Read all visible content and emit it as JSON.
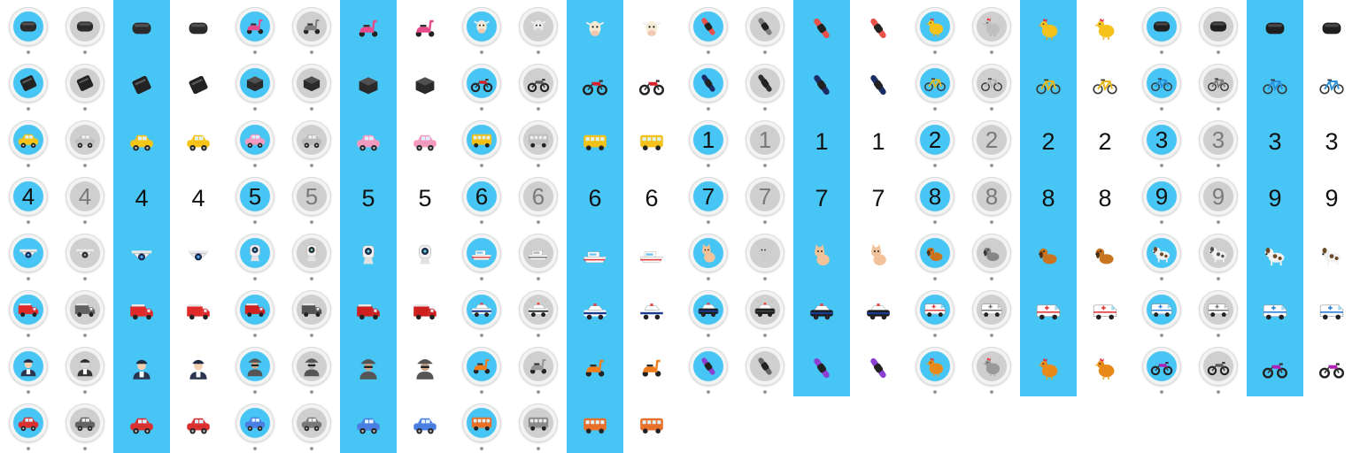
{
  "sheet": {
    "colors": {
      "band": "#47c6f5",
      "badge_color": "#47c6f5",
      "badge_gray": "#cfcfcf",
      "ring": "#f4f4f4",
      "pin_dot": "#9a9a9a"
    },
    "variants": [
      "badge-color",
      "badge-gray",
      "band",
      "plain"
    ],
    "rows": [
      [
        "tracker-black",
        "scooter-pink",
        "cow",
        "wristband-red",
        "chicken",
        "tracker-box"
      ],
      [
        "tracker-slim",
        "tracker-cube",
        "motorcycle-red",
        "wristband-navy",
        "bicycle-yellow",
        "bicycle-blue"
      ],
      [
        "car-yellow",
        "car-pink",
        "bus-yellow",
        "1",
        "2",
        "3"
      ],
      [
        "4",
        "5",
        "6",
        "7",
        "8",
        "9"
      ],
      [
        "camera-dome",
        "camera-cube",
        "boat",
        "cat",
        "dog-brown",
        "dog-spotted"
      ],
      [
        "fire-truck",
        "fire-engine",
        "police-car",
        "police-suv",
        "ambulance-red",
        "ambulance-blue"
      ],
      [
        "police-officer",
        "spy",
        "scooter-orange",
        "wristband-purple",
        "chicken-orange",
        "motorcycle-purple"
      ],
      [
        "car-red",
        "car-blue",
        "bus-orange"
      ]
    ]
  }
}
